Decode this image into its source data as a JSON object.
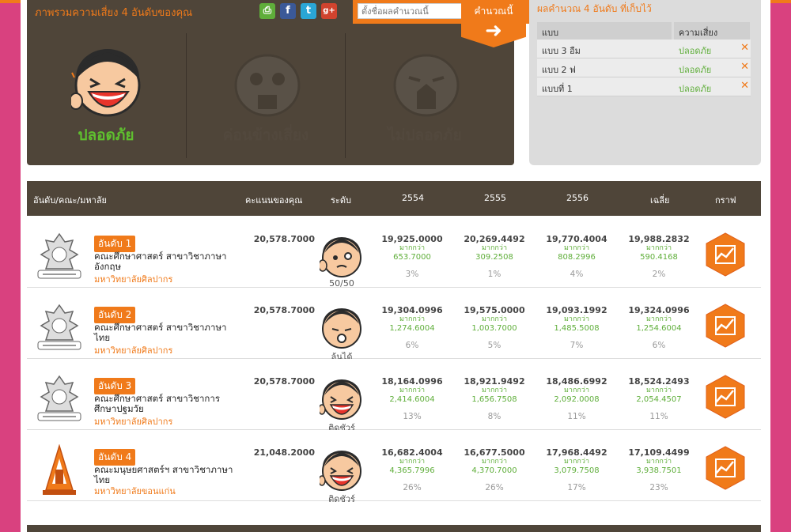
{
  "header": {
    "title": "ภาพรวมความเสี่ยง 4 อันดับของคุณ",
    "share": {
      "print": "⎙",
      "facebook": "f",
      "twitter": "t",
      "gplus": "g+"
    },
    "search_placeholder": "ตั้งชื่อผลคำนวณนี้",
    "calc_label": "คำนวณนี้",
    "calc_arrow": "➜"
  },
  "risk_levels": [
    {
      "label": "ปลอดภัย",
      "active": true
    },
    {
      "label": "ค่อนข้างเสี่ยง",
      "active": false
    },
    {
      "label": "ไม่ปลอดภัย",
      "active": false
    }
  ],
  "saved": {
    "title": "ผลคำนวณ 4 อันดับ ที่เก็บไว้",
    "col_name": "แบบ",
    "col_risk": "ความเสี่ยง",
    "rows": [
      {
        "name": "แบบ 3 อืม",
        "risk": "ปลอดภัย",
        "remove": "✕"
      },
      {
        "name": "แบบ 2 ฟ",
        "risk": "ปลอดภัย",
        "remove": "✕"
      },
      {
        "name": "แบบที่ 1",
        "risk": "ปลอดภัย",
        "remove": "✕"
      }
    ]
  },
  "table": {
    "headers": {
      "rank": "อันดับ/คณะ/มหาลัย",
      "score": "คะแนนของคุณ",
      "level": "ระดับ",
      "y2554": "2554",
      "y2555": "2555",
      "y2556": "2556",
      "avg": "เฉลี่ย",
      "graph": "กราฟ"
    },
    "rows": [
      {
        "rank": "อันดับ 1",
        "faculty": "คณะศึกษาศาสตร์ สาขาวิชาภาษาอังกฤษ",
        "university": "มหาวิทยาลัยศิลปากร",
        "score": "20,578.7000",
        "level": "50/50",
        "years": [
          {
            "value": "19,925.0000",
            "more": "มากกว่า",
            "diff": "653.7000",
            "pct": "3%"
          },
          {
            "value": "20,269.4492",
            "more": "มากกว่า",
            "diff": "309.2508",
            "pct": "1%"
          },
          {
            "value": "19,770.4004",
            "more": "มากกว่า",
            "diff": "808.2996",
            "pct": "4%"
          },
          {
            "value": "19,988.2832",
            "more": "มากกว่า",
            "diff": "590.4168",
            "pct": "2%"
          }
        ]
      },
      {
        "rank": "อันดับ 2",
        "faculty": "คณะศึกษาศาสตร์ สาขาวิชาภาษาไทย",
        "university": "มหาวิทยาลัยศิลปากร",
        "score": "20,578.7000",
        "level": "ลุ้นได้",
        "years": [
          {
            "value": "19,304.0996",
            "more": "มากกว่า",
            "diff": "1,274.6004",
            "pct": "6%"
          },
          {
            "value": "19,575.0000",
            "more": "มากกว่า",
            "diff": "1,003.7000",
            "pct": "5%"
          },
          {
            "value": "19,093.1992",
            "more": "มากกว่า",
            "diff": "1,485.5008",
            "pct": "7%"
          },
          {
            "value": "19,324.0996",
            "more": "มากกว่า",
            "diff": "1,254.6004",
            "pct": "6%"
          }
        ]
      },
      {
        "rank": "อันดับ 3",
        "faculty": "คณะศึกษาศาสตร์ สาขาวิชาการศึกษาปฐมวัย",
        "university": "มหาวิทยาลัยศิลปากร",
        "score": "20,578.7000",
        "level": "ติดชัวร์",
        "years": [
          {
            "value": "18,164.0996",
            "more": "มากกว่า",
            "diff": "2,414.6004",
            "pct": "13%"
          },
          {
            "value": "18,921.9492",
            "more": "มากกว่า",
            "diff": "1,656.7508",
            "pct": "8%"
          },
          {
            "value": "18,486.6992",
            "more": "มากกว่า",
            "diff": "2,092.0008",
            "pct": "11%"
          },
          {
            "value": "18,524.2493",
            "more": "มากกว่า",
            "diff": "2,054.4507",
            "pct": "11%"
          }
        ]
      },
      {
        "rank": "อันดับ 4",
        "faculty": "คณะมนุษยศาสตร์ฯ สาขาวิชาภาษาไทย",
        "university": "มหาวิทยาลัยขอนแก่น",
        "score": "21,048.2000",
        "level": "ติดชัวร์",
        "years": [
          {
            "value": "16,682.4004",
            "more": "มากกว่า",
            "diff": "4,365.7996",
            "pct": "26%"
          },
          {
            "value": "16,677.5000",
            "more": "มากกว่า",
            "diff": "4,370.7000",
            "pct": "26%"
          },
          {
            "value": "17,968.4492",
            "more": "มากกว่า",
            "diff": "3,079.7508",
            "pct": "17%"
          },
          {
            "value": "17,109.4499",
            "more": "มากกว่า",
            "diff": "3,938.7501",
            "pct": "23%"
          }
        ]
      }
    ]
  },
  "colors": {
    "accent": "#f07a1a",
    "dark": "#4f4539",
    "safe": "#5fbf2f",
    "background": "#d9417f"
  }
}
